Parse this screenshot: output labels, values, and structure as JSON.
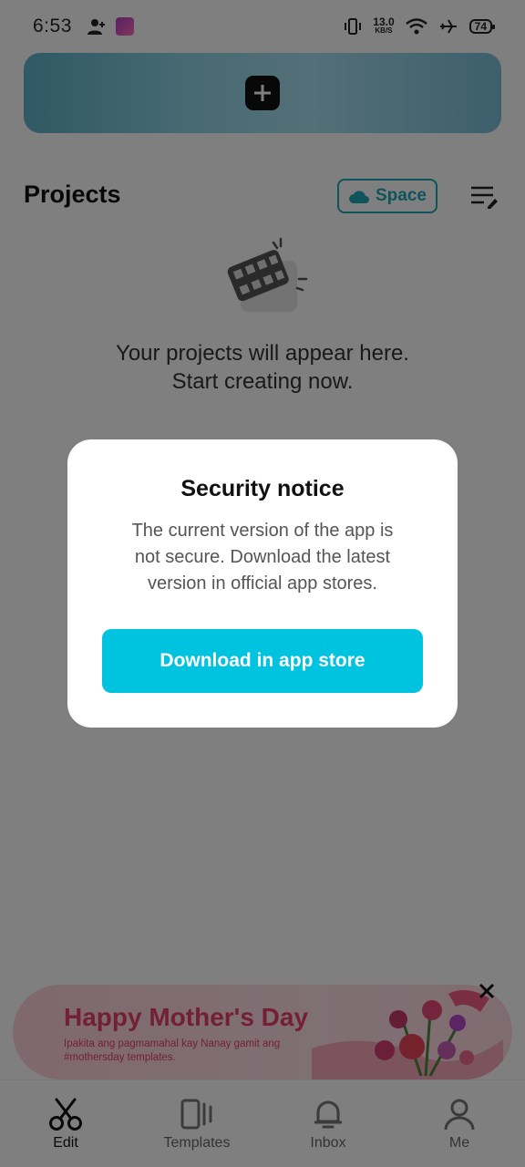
{
  "status_bar": {
    "time": "6:53",
    "net_speed_value": "13.0",
    "net_speed_unit": "KB/S",
    "battery": "74",
    "icons": [
      "person-add-icon",
      "app-notification-icon",
      "vibrate-icon",
      "wifi-icon",
      "airplane-icon",
      "battery-icon"
    ]
  },
  "projects": {
    "title": "Projects",
    "space_label": "Space",
    "empty_line1": "Your projects will appear here.",
    "empty_line2": "Start creating now."
  },
  "dialog": {
    "title": "Security notice",
    "message_line1": "The current version of the app is",
    "message_line2": "not secure. Download the latest",
    "message_line3": "version in official app stores.",
    "button_label": "Download in app store"
  },
  "promo": {
    "title": "Happy Mother's Day",
    "subtitle": "Ipakita ang pagmamahal kay Nanay gamit ang #mothersday templates."
  },
  "bottom_nav": {
    "items": [
      {
        "label": "Edit",
        "icon": "scissors-icon",
        "active": true
      },
      {
        "label": "Templates",
        "icon": "templates-icon",
        "active": false
      },
      {
        "label": "Inbox",
        "icon": "bell-icon",
        "active": false
      },
      {
        "label": "Me",
        "icon": "person-icon",
        "active": false
      }
    ]
  },
  "colors": {
    "accent": "#00c3df",
    "space_accent": "#1fa8b5",
    "promo_text": "#e7406b",
    "overlay": "rgba(0,0,0,0.5)"
  }
}
